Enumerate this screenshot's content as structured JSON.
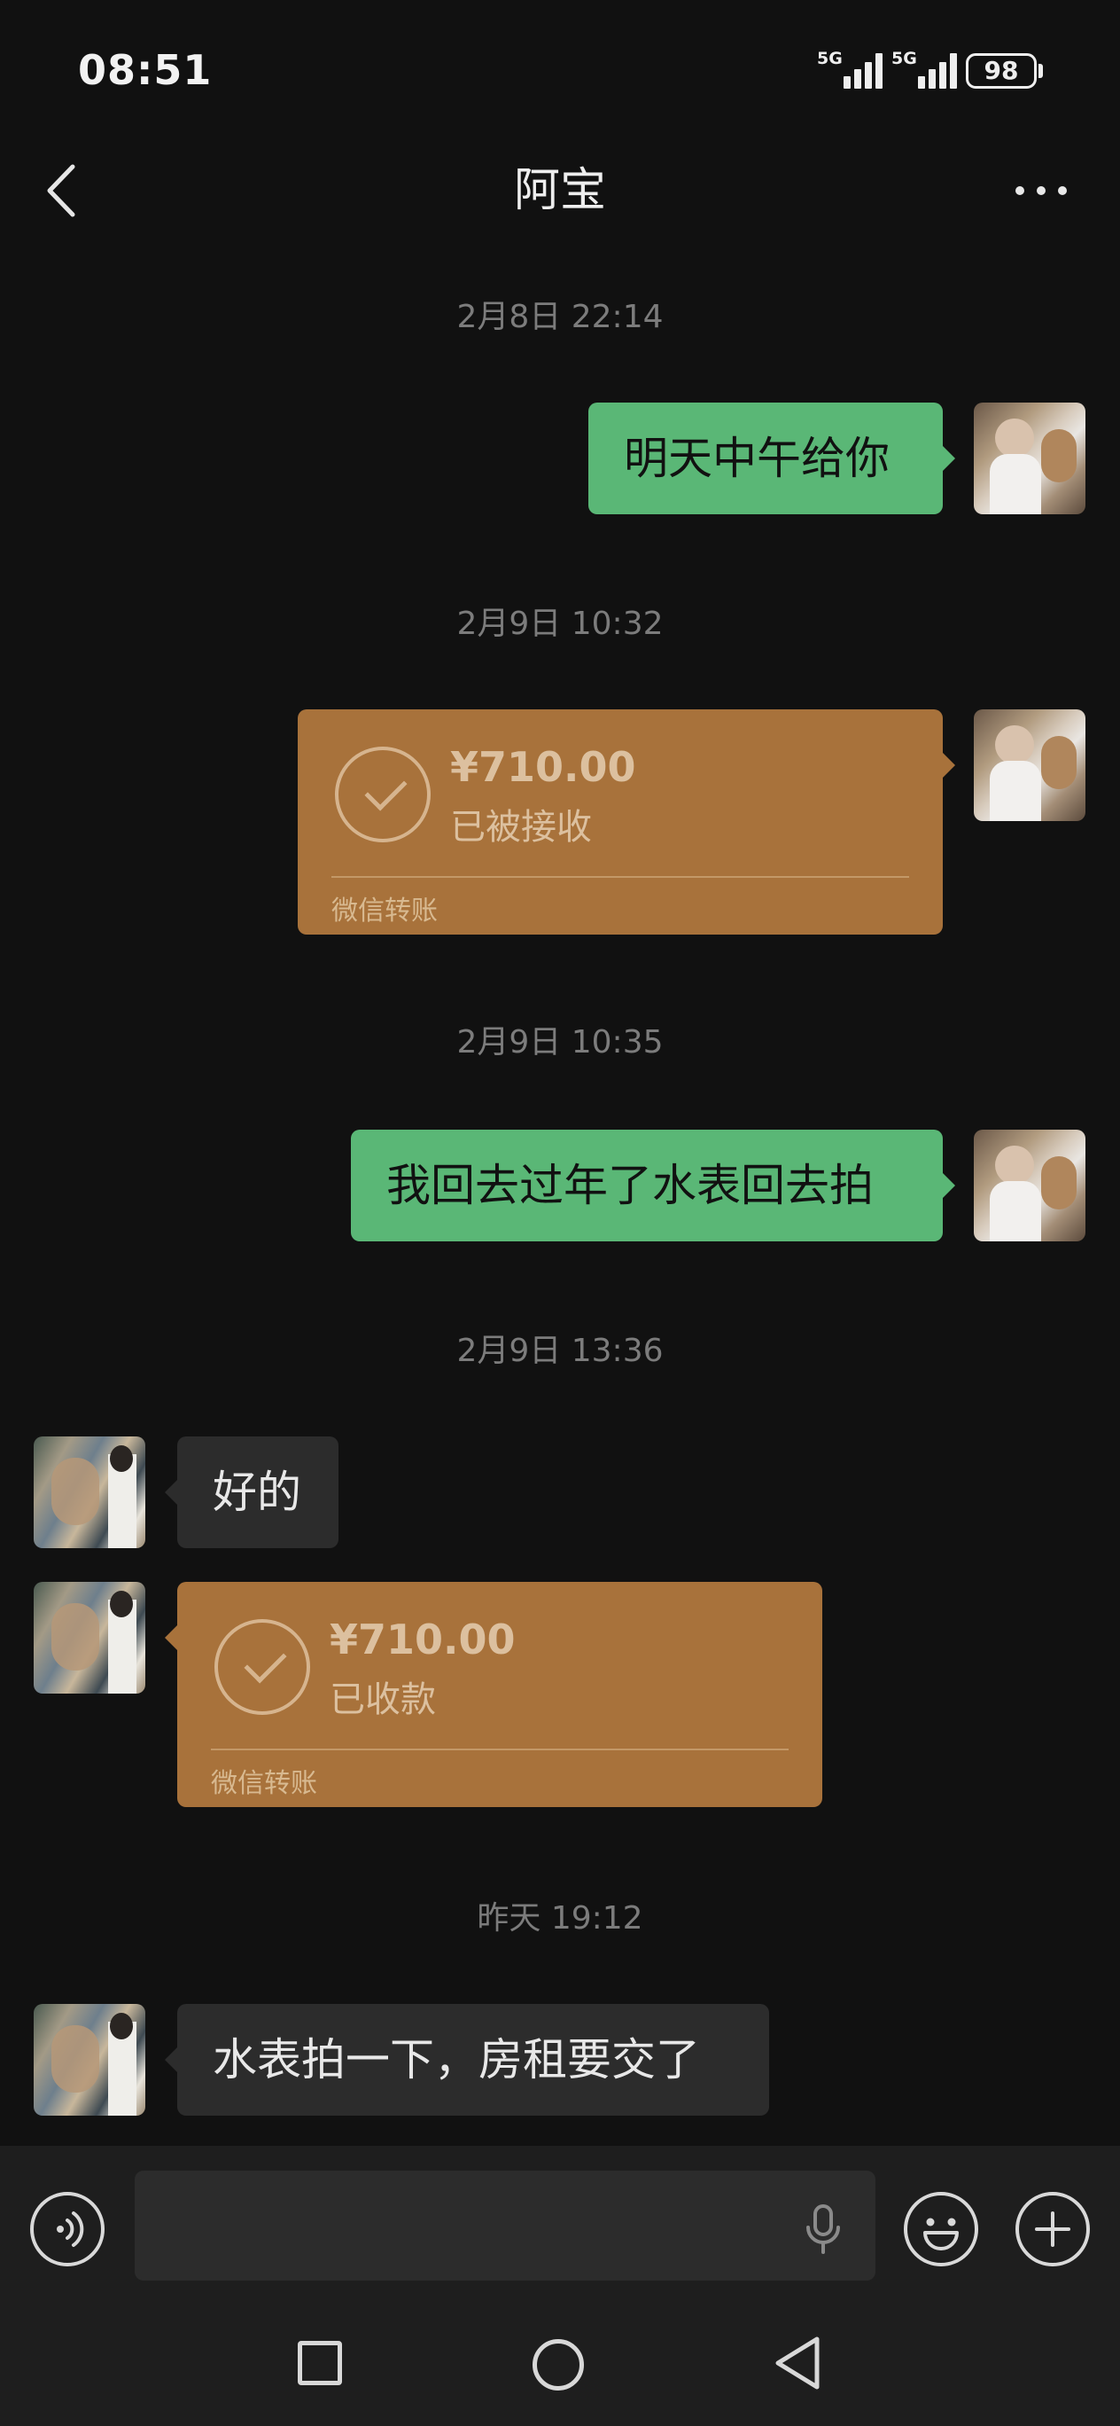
{
  "status_bar": {
    "time": "08:51",
    "signal_1": "5G",
    "signal_2": "5G",
    "battery": "98"
  },
  "header": {
    "title": "阿宝",
    "back_icon": "chevron-left-icon",
    "more_icon": "more-horizontal-icon"
  },
  "messages": [
    {
      "timestamp": "2月8日 22:14"
    },
    {
      "text": "明天中午给你",
      "direction": "outgoing"
    },
    {
      "timestamp": "2月9日 10:32"
    },
    {
      "type": "transfer",
      "direction": "outgoing",
      "amount": "¥710.00",
      "status": "已被接收",
      "caption": "微信转账"
    },
    {
      "timestamp": "2月9日 10:35"
    },
    {
      "text": "我回去过年了水表回去拍",
      "direction": "outgoing"
    },
    {
      "timestamp": "2月9日 13:36"
    },
    {
      "text": "好的",
      "direction": "incoming"
    },
    {
      "type": "transfer",
      "direction": "incoming",
      "amount": "¥710.00",
      "status": "已收款",
      "caption": "微信转账"
    },
    {
      "timestamp": "昨天 19:12"
    },
    {
      "text": "水表拍一下，房租要交了",
      "direction": "incoming"
    }
  ],
  "input_bar": {
    "voice_icon": "voice-icon",
    "input_value": "",
    "mic_icon": "microphone-icon",
    "emoji_icon": "emoji-icon",
    "plus_icon": "plus-circle-icon"
  },
  "colors": {
    "background": "#111111",
    "outgoing_bubble": "#5ab776",
    "incoming_bubble": "#2c2c2c",
    "transfer_card": "#a8723b"
  }
}
